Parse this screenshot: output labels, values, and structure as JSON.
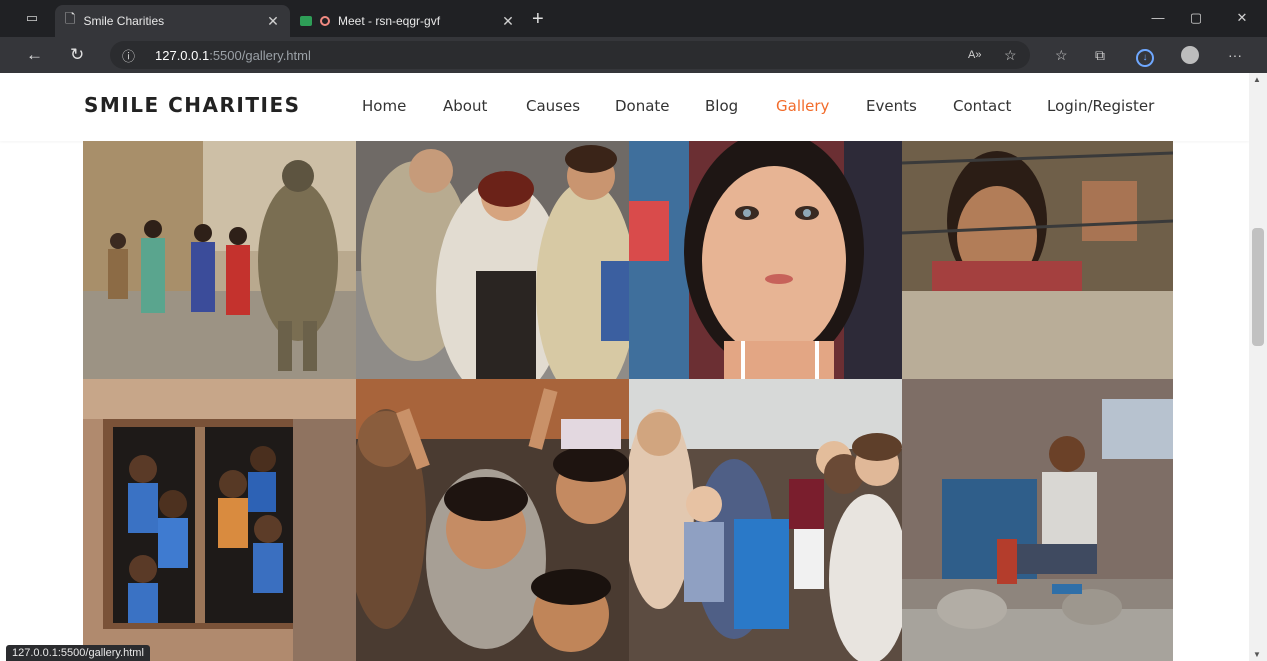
{
  "browser": {
    "tabs": [
      {
        "title": "Smile Charities",
        "active": true
      },
      {
        "title": "Meet - rsn-eqgr-gvf",
        "active": false
      }
    ],
    "url_host": "127.0.0.1",
    "url_path": ":5500/gallery.html",
    "status_bar": "127.0.0.1:5500/gallery.html",
    "icons": {
      "window": "window-icon",
      "back": "back-arrow-icon",
      "reload": "reload-icon",
      "info": "info-icon",
      "read_aloud": "read-aloud-icon",
      "favorite": "favorite-star-icon",
      "favorites": "favorites-list-icon",
      "collections": "collections-icon",
      "downloads": "download-icon",
      "profile": "profile-icon",
      "menu": "more-menu-icon"
    }
  },
  "site": {
    "logo": "SMILE CHARITIES",
    "nav": [
      "Home",
      "About",
      "Causes",
      "Donate",
      "Blog",
      "Gallery",
      "Events",
      "Contact",
      "Login/Register"
    ],
    "active_nav": "Gallery",
    "accent_color": "#f26c2b"
  },
  "gallery": {
    "images": [
      "children-walking-with-soldier-photo",
      "children-in-headscarves-photo",
      "girl-portrait-closeup-photo",
      "boy-behind-barbed-wire-photo",
      "children-in-window-photo",
      "children-peace-signs-photo",
      "volunteers-with-children-photo",
      "boy-sitting-on-rocks-photo"
    ]
  }
}
